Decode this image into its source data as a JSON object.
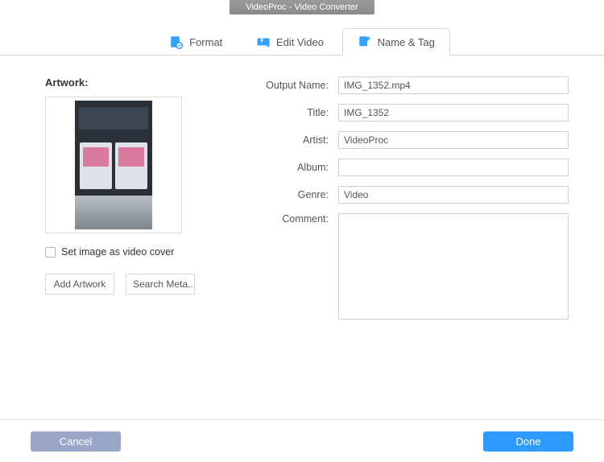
{
  "window": {
    "title": "VideoProc - Video Converter"
  },
  "tabs": {
    "format": "Format",
    "edit_video": "Edit Video",
    "name_tag": "Name & Tag"
  },
  "artwork": {
    "label": "Artwork:",
    "cover_checkbox_label": "Set image as video cover",
    "add_button": "Add Artwork",
    "search_button": "Search Meta..."
  },
  "fields": {
    "output_name": {
      "label": "Output Name:",
      "value": "IMG_1352.mp4"
    },
    "title": {
      "label": "Title:",
      "value": "IMG_1352"
    },
    "artist": {
      "label": "Artist:",
      "value": "VideoProc"
    },
    "album": {
      "label": "Album:",
      "value": ""
    },
    "genre": {
      "label": "Genre:",
      "value": "Video"
    },
    "comment": {
      "label": "Comment:",
      "value": ""
    }
  },
  "footer": {
    "cancel": "Cancel",
    "done": "Done"
  }
}
